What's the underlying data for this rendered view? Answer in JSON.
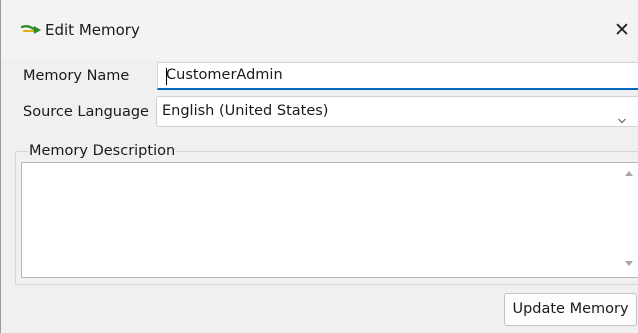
{
  "window": {
    "title": "Edit Memory",
    "app_icon": "memory-arrow-icon",
    "close_icon": "close-icon",
    "close_glyph": "✕"
  },
  "form": {
    "memory_name_label": "Memory Name",
    "memory_name_value": "CustomerAdmin",
    "source_language_label": "Source Language",
    "source_language_value": "English (United States)",
    "source_language_icon": "chevron-down-icon",
    "description_label": "Memory Description",
    "description_value": ""
  },
  "actions": {
    "update_label": "Update Memory"
  },
  "colors": {
    "focus_accent": "#0067c0",
    "icon_green": "#2e8b2e",
    "icon_yellow": "#e0b000"
  }
}
